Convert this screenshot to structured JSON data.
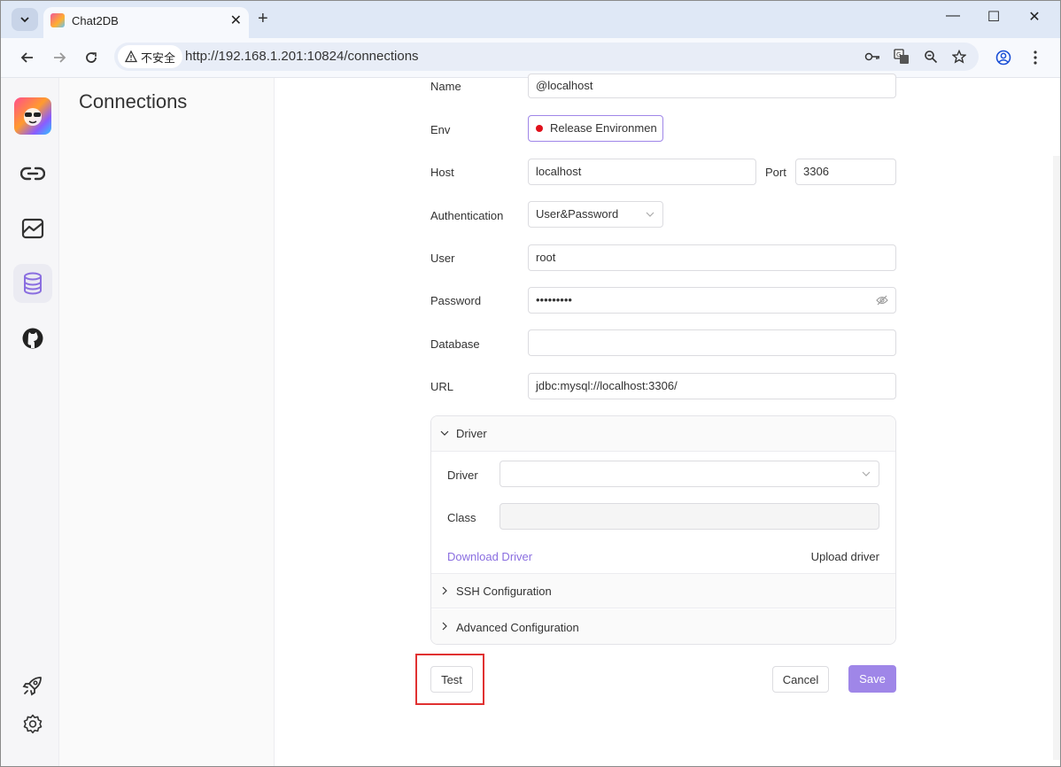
{
  "browser": {
    "tab_title": "Chat2DB",
    "security_label": "不安全",
    "url": "http://192.168.1.201:10824/connections"
  },
  "panel": {
    "title": "Connections"
  },
  "form": {
    "name_label": "Name",
    "name_value": "@localhost",
    "env_label": "Env",
    "env_value": "Release Environment",
    "host_label": "Host",
    "host_value": "localhost",
    "port_label": "Port",
    "port_value": "3306",
    "auth_label": "Authentication",
    "auth_value": "User&Password",
    "user_label": "User",
    "user_value": "root",
    "password_label": "Password",
    "password_value": "•••••••••",
    "database_label": "Database",
    "database_value": "",
    "url_label": "URL",
    "url_value": "jdbc:mysql://localhost:3306/"
  },
  "driver_section": {
    "header": "Driver",
    "driver_label": "Driver",
    "driver_value": "",
    "class_label": "Class",
    "class_value": "",
    "download_link": "Download Driver",
    "upload_label": "Upload driver"
  },
  "ssh_section": {
    "header": "SSH Configuration"
  },
  "advanced_section": {
    "header": "Advanced Configuration"
  },
  "actions": {
    "test": "Test",
    "cancel": "Cancel",
    "save": "Save"
  },
  "colors": {
    "accent": "#9f86e8",
    "env_dot": "#e0101b",
    "highlight": "#e03131"
  }
}
